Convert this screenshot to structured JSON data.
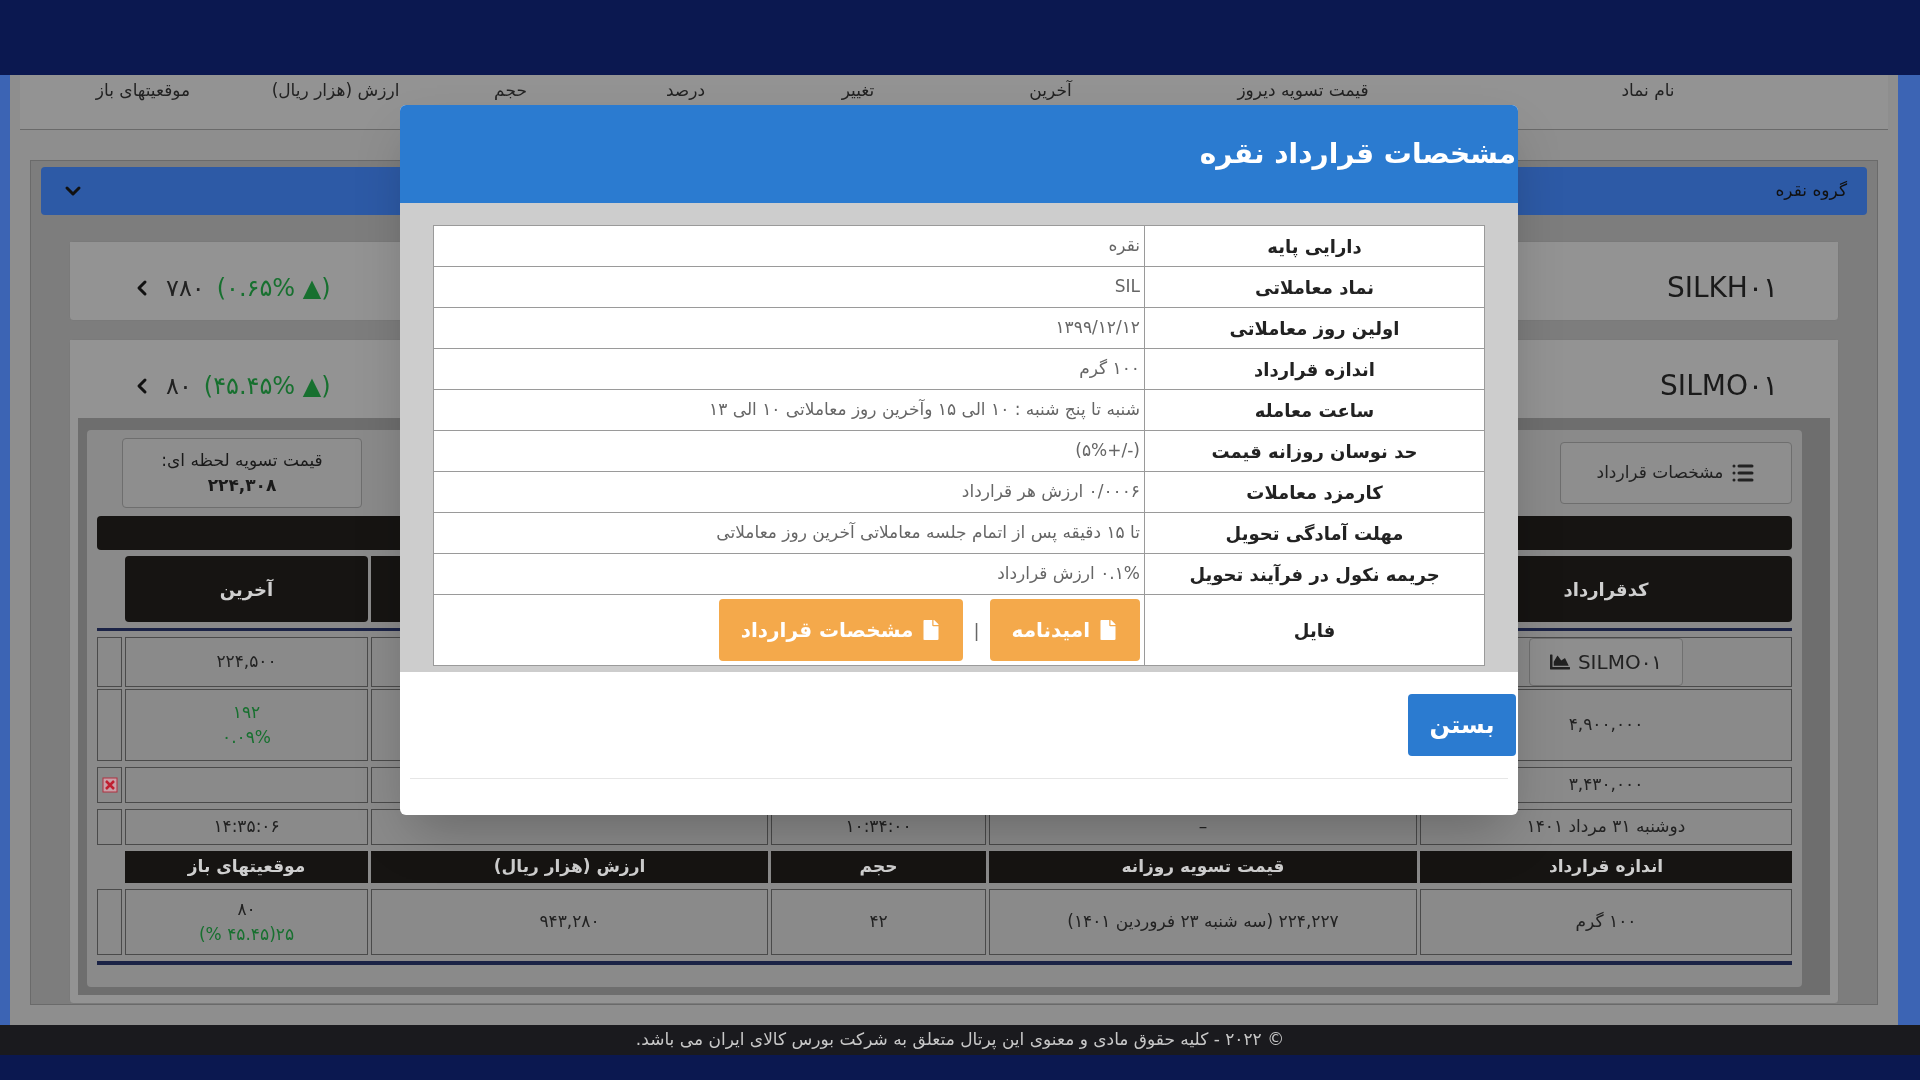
{
  "column_headers": [
    "نام نماد",
    "قیمت تسویه دیروز",
    "آخرین",
    "تغییر",
    "درصد",
    "حجم",
    "ارزش (هزار ریال)",
    "موقعیتهای باز"
  ],
  "group": {
    "title": "گروه نقره",
    "expanded": true
  },
  "contracts": [
    {
      "symbol": "SILKH۰۱",
      "last": "۷۸۰",
      "change": "(۰.۶۵% ▲)",
      "positive": true
    },
    {
      "symbol": "SILMO۰۱",
      "last": "۸۰",
      "change": "(۴۵.۴۵% ▲)",
      "positive": true
    }
  ],
  "detail": {
    "settlement_label": "قیمت تسویه لحظه ای:",
    "settlement_value": "۲۲۴,۳۰۸",
    "specs_button": "مشخصات قرارداد",
    "top_header": {
      "col_1": "کدقرارداد",
      "col_5": "آخرین"
    },
    "upper_rows": [
      {
        "marker": false,
        "col_1": {
          "kind": "button",
          "lines": [
            {
              "text": "SILMO۰۱"
            }
          ]
        },
        "col_5": {
          "lines": [
            {
              "text": "۲۲۴,۵۰۰"
            }
          ]
        }
      },
      {
        "marker": false,
        "col_1": {
          "lines": [
            {
              "text": "۴,۹۰۰,۰۰۰"
            }
          ]
        },
        "col_5": {
          "lines": [
            {
              "text": "۱۹۲",
              "positive": true
            },
            {
              "text": "۰.۰۹%",
              "positive": true
            }
          ]
        }
      },
      {
        "marker": true,
        "col_1": {
          "lines": [
            {
              "text": "۳,۴۳۰,۰۰۰"
            }
          ]
        }
      },
      {
        "marker": false,
        "col_1": {
          "lines": [
            {
              "text": "دوشنبه ۳۱ مرداد ۱۴۰۱"
            }
          ]
        },
        "col_2": {
          "lines": [
            {
              "text": "–"
            }
          ]
        },
        "col_3": {
          "lines": [
            {
              "text": "۱۰:۳۴:۰۰"
            }
          ]
        },
        "col_5": {
          "lines": [
            {
              "text": "۱۴:۳۵:۰۶"
            }
          ]
        }
      }
    ],
    "lower_header": [
      "اندازه قرارداد",
      "قیمت تسویه روزانه",
      "حجم",
      "ارزش (هزار ریال)",
      "موقعیتهای باز"
    ],
    "lower_row": [
      {
        "lines": [
          {
            "text": "۱۰۰ گرم"
          }
        ]
      },
      {
        "lines": [
          {
            "text": "۲۲۴,۲۲۷ (سه شنبه ۲۳ فروردین ۱۴۰۱)"
          }
        ]
      },
      {
        "lines": [
          {
            "text": "۴۲"
          }
        ]
      },
      {
        "lines": [
          {
            "text": "۹۴۳,۲۸۰"
          }
        ]
      },
      {
        "lines": [
          {
            "text": "۸۰"
          },
          {
            "text": "۲۵(۴۵.۴۵ %)",
            "positive": true
          }
        ]
      }
    ]
  },
  "modal": {
    "title": "مشخصات قرارداد نقره",
    "rows": [
      {
        "label": "دارایی پایه",
        "value": "نقره"
      },
      {
        "label": "نماد معاملاتی",
        "value": "SIL"
      },
      {
        "label": "اولین روز معاملاتی",
        "value": "۱۳۹۹/۱۲/۱۲"
      },
      {
        "label": "اندازه قرارداد",
        "value": "۱۰۰ گرم"
      },
      {
        "label": "ساعت معامله",
        "value": "شنبه تا پنج شنبه : ۱۰ الی ۱۵ وآخرین روز معاملاتی ۱۰ الی ۱۳"
      },
      {
        "label": "حد نوسان روزانه قیمت",
        "value": "(-/+۵%)"
      },
      {
        "label": "کارمزد معاملات",
        "value": "۰/۰۰۰۶ ارزش هر قرارداد"
      },
      {
        "label": "مهلت آمادگی تحویل",
        "value": "تا ۱۵ دقیقه پس از اتمام جلسه معاملاتی آخرین روز معاملاتی"
      },
      {
        "label": "جریمه نکول در فرآیند تحویل",
        "value": "۰.۱% ارزش قرارداد"
      }
    ],
    "file_label": "فایل",
    "file_buttons": [
      "امیدنامه",
      "مشخصات قرارداد"
    ],
    "separator": "|",
    "close": "بستن"
  },
  "footer": "© ۲۰۲۲ - کلیه حقوق مادی و معنوی این پرتال متعلق به شرکت بورس کالای ایران می باشد."
}
